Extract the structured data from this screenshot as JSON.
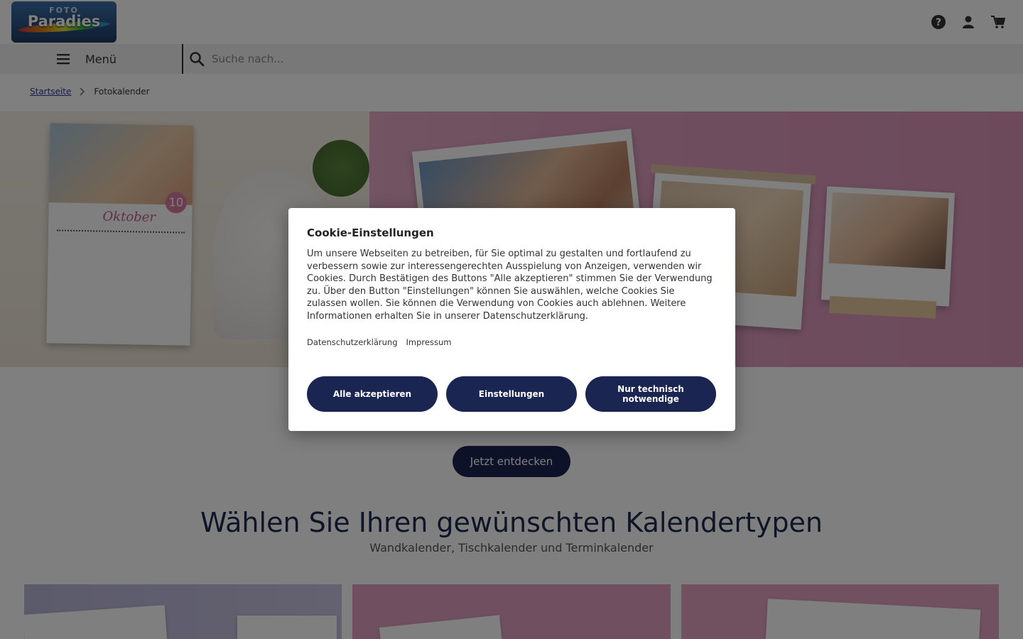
{
  "header": {
    "logo_top": "FOTO",
    "logo_main": "Paradies",
    "icons": [
      "help-icon",
      "user-icon",
      "cart-icon"
    ]
  },
  "nav": {
    "menu_label": "Menü",
    "search_placeholder": "Suche nach..."
  },
  "breadcrumb": {
    "home": "Startseite",
    "current": "Fotokalender"
  },
  "hero": {
    "calendar_month": "Oktober",
    "calendar_day": "10"
  },
  "main": {
    "discover_button": "Jetzt entdecken",
    "section_title": "Wählen Sie Ihren gewünschten Kalendertypen",
    "section_subtitle": "Wandkalender, Tischkalender und Terminkalender"
  },
  "cookie": {
    "title": "Cookie-Einstellungen",
    "text": "Um unsere Webseiten zu betreiben, für Sie optimal zu gestalten und fortlaufend zu verbessern sowie zur interessengerechten Ausspielung von Anzeigen, verwenden wir Cookies. Durch Bestätigen des Buttons \"Alle akzeptieren\" stimmen Sie der Verwendung zu. Über den Button \"Einstellungen\" können Sie auswählen, welche Cookies Sie zulassen wollen. Sie können die Verwendung von Cookies auch ablehnen. Weitere Informationen erhalten Sie in unserer Datenschutzerklärung.",
    "link_privacy": "Datenschutzerklärung",
    "link_imprint": "Impressum",
    "btn_accept_all": "Alle akzeptieren",
    "btn_settings": "Einstellungen",
    "btn_necessary": "Nur technisch notwendige"
  },
  "colors": {
    "primary": "#1b2552",
    "link": "#2a3a9a"
  }
}
